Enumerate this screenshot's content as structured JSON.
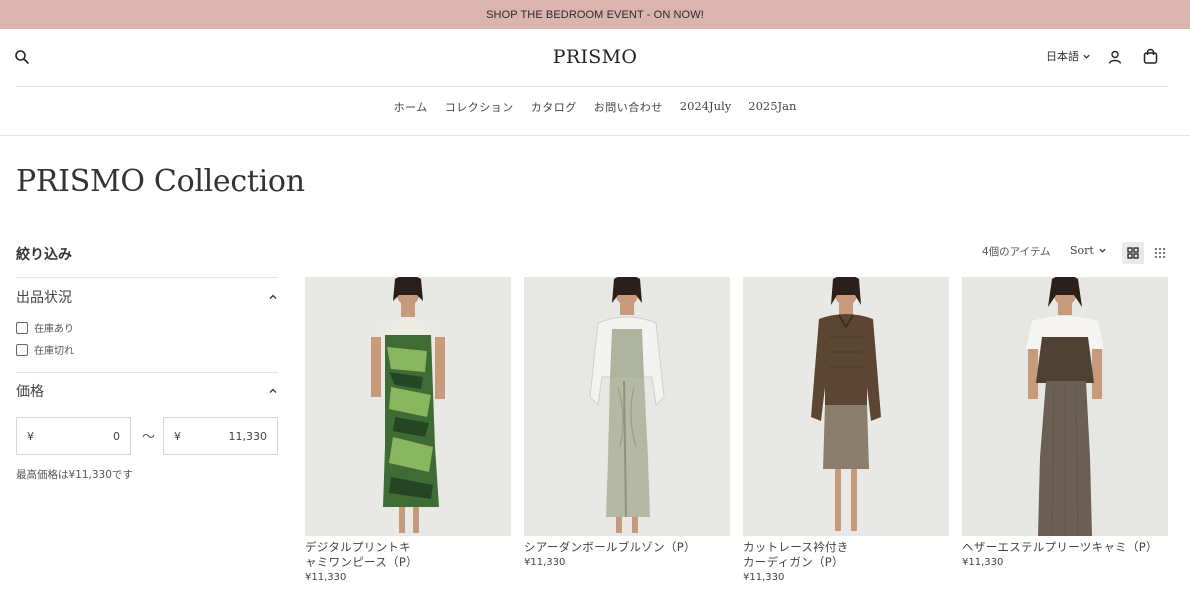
{
  "announcement": "SHOP THE BEDROOM EVENT - ON NOW!",
  "header": {
    "logo": "PRISMO",
    "language": "日本語"
  },
  "nav": [
    "ホーム",
    "コレクション",
    "カタログ",
    "お問い合わせ",
    "2024July",
    "2025Jan"
  ],
  "page_title": "PRISMO Collection",
  "filters": {
    "title": "絞り込み",
    "availability": {
      "label": "出品状況",
      "options": [
        "在庫あり",
        "在庫切れ"
      ]
    },
    "price": {
      "label": "価格",
      "currency": "¥",
      "min_value": "0",
      "max_value": "11,330",
      "separator": "〜",
      "max_note": "最高価格は¥11,330です"
    }
  },
  "toolbar": {
    "count": "4個のアイテム",
    "sort_label": "Sort"
  },
  "products": [
    {
      "name": "デジタルプリントキャミワンピース（P）",
      "name_line1": "デジタルプリントキ",
      "name_line2": "ャミワンピース（P）",
      "price": "¥11,330"
    },
    {
      "name": "シアーダンボールブルゾン（P）",
      "name_line1": "シアーダンボールブルゾン（P）",
      "name_line2": "",
      "price": "¥11,330"
    },
    {
      "name": "カットレース衿付きカーディガン（P）",
      "name_line1": "カットレース衿付き",
      "name_line2": "カーディガン（P）",
      "price": "¥11,330"
    },
    {
      "name": "ヘザーエステルプリーツキャミ（P）",
      "name_line1": "ヘザーエステルプリーツキャミ（P）",
      "name_line2": "",
      "price": "¥11,330"
    }
  ],
  "colors": {
    "announcement_bg": "#dbb4b0",
    "text": "#333333",
    "divider": "#e2e2e2",
    "photo_bg": "#e7e8e4"
  }
}
